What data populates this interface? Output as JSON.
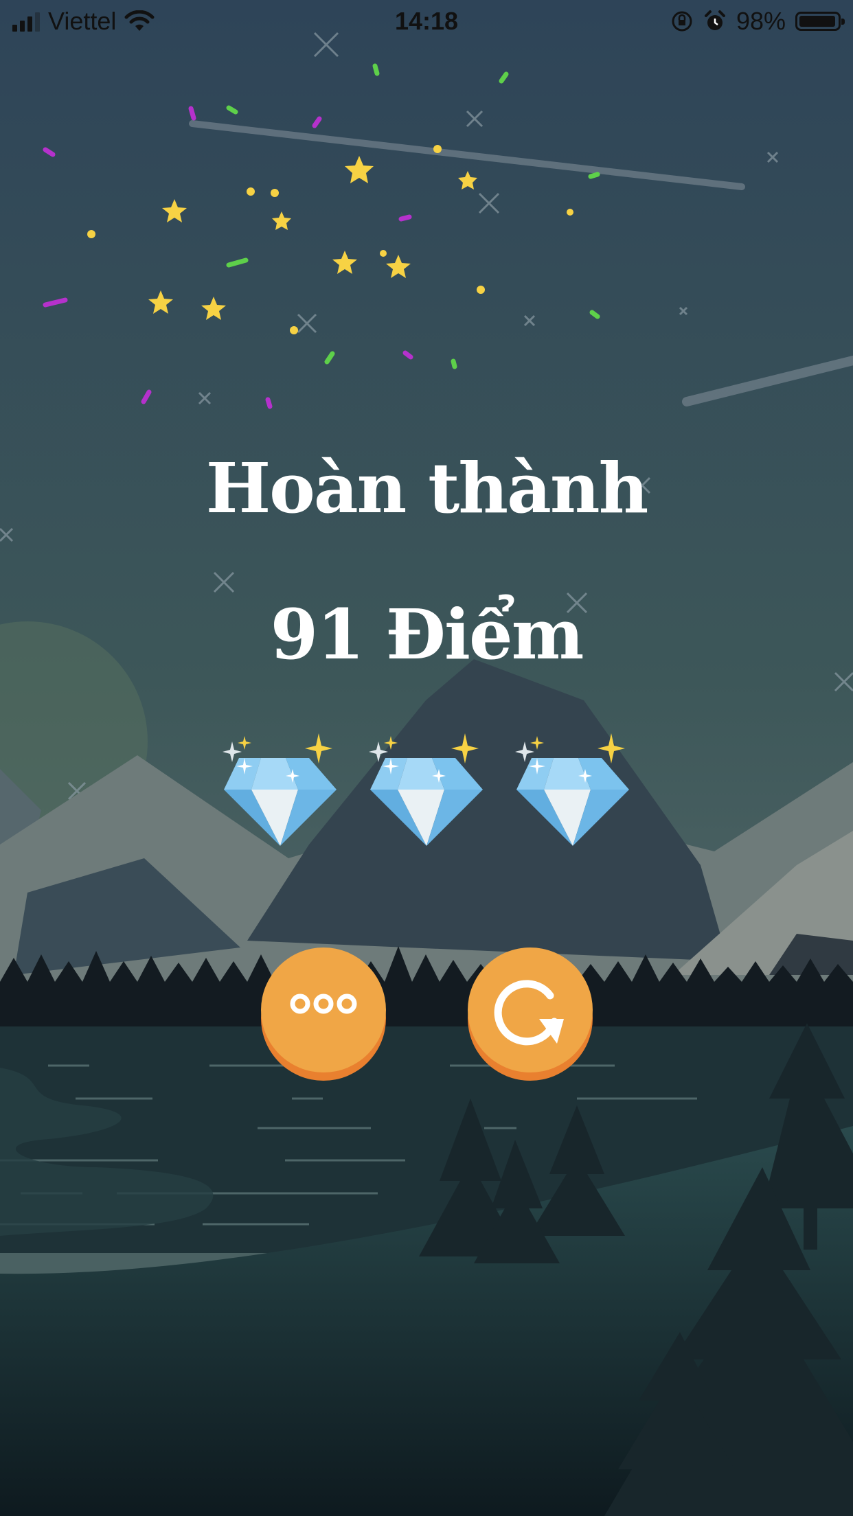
{
  "status_bar": {
    "carrier": "Viettel",
    "time": "14:18",
    "battery_percent": "98%",
    "icons": [
      "signal-icon",
      "wifi-icon",
      "orientation-lock-icon",
      "alarm-icon",
      "battery-icon"
    ]
  },
  "result": {
    "title": "Hoàn thành",
    "score_text": "91 Điểm",
    "gems_earned": 3,
    "gems_total": 3
  },
  "actions": [
    {
      "name": "more-options",
      "icon": "three-dots-icon"
    },
    {
      "name": "replay",
      "icon": "replay-icon"
    }
  ],
  "colors": {
    "sky_top": "#2e4458",
    "sky_mid": "#3d5759",
    "button_orange": "#f0a646",
    "button_shadow": "#e9802f",
    "gem_blue": "#6ab7e6",
    "star_yellow": "#f7d244",
    "confetti_green": "#5ed04a",
    "confetti_purple": "#b531cc"
  }
}
